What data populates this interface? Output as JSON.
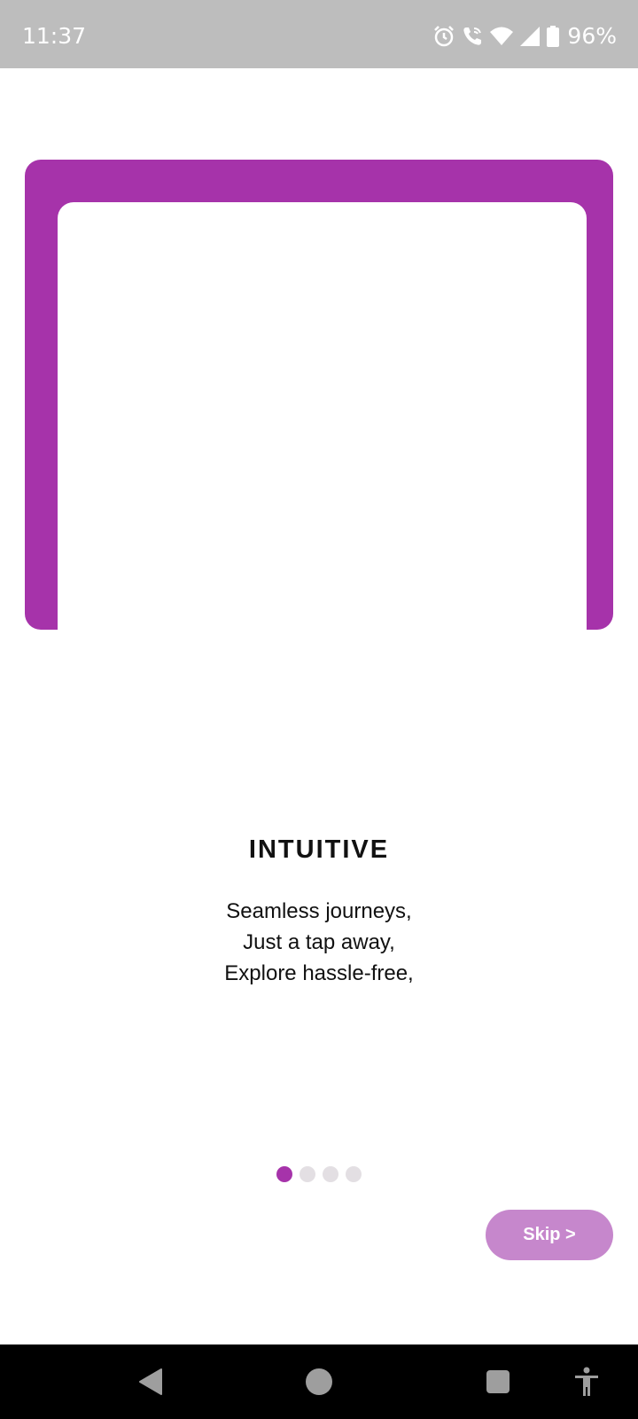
{
  "status_bar": {
    "time": "11:37",
    "battery_percent": "96%",
    "icons": [
      "alarm-icon",
      "wifi-call-icon",
      "wifi-icon",
      "signal-icon",
      "battery-icon"
    ]
  },
  "onboarding": {
    "title": "INTUITIVE",
    "lines": [
      "Seamless journeys,",
      "Just a tap away,",
      "Explore hassle-free,"
    ],
    "page_count": 4,
    "active_page": 1,
    "skip_label": "Skip >"
  },
  "nav_bar": {
    "icons": [
      "back-icon",
      "home-icon",
      "recents-icon",
      "accessibility-icon"
    ]
  },
  "colors": {
    "accent": "#a633aa",
    "skip_button": "#c687cc",
    "status_bar": "#bdbdbd",
    "inactive_dot": "#e3dfe3"
  }
}
